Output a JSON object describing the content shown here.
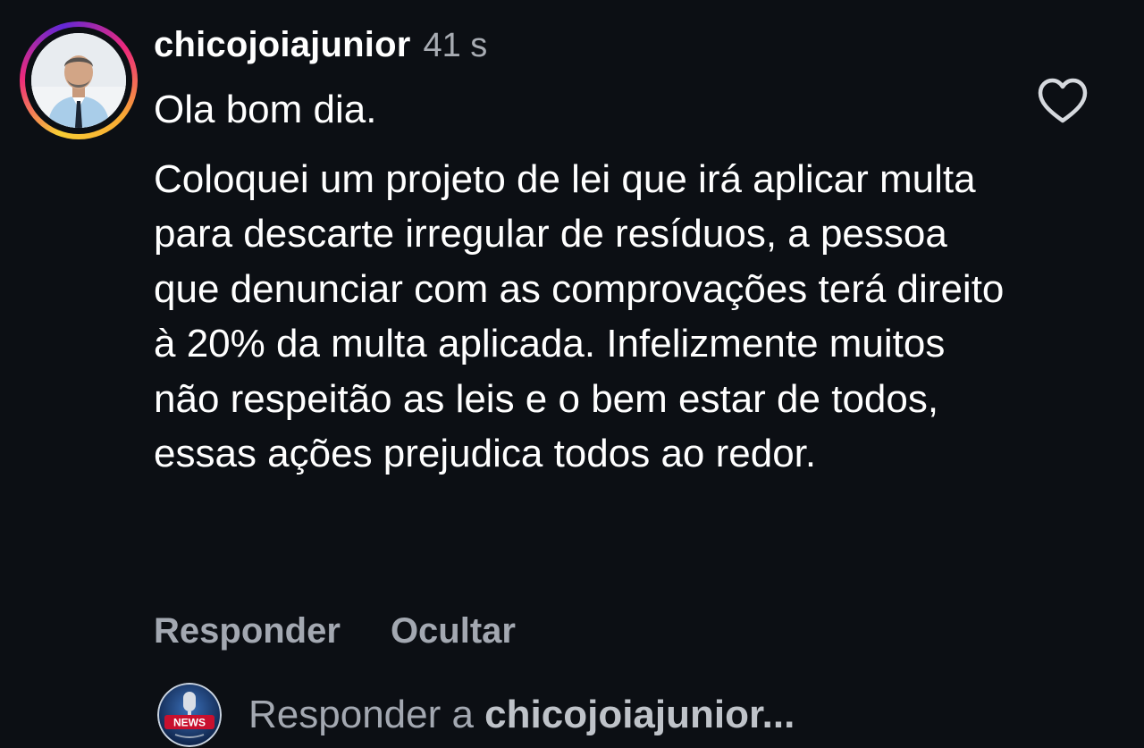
{
  "comment": {
    "username": "chicojoiajunior",
    "time": "41 s",
    "greeting": "Ola bom dia.",
    "body": "Coloquei um projeto de lei que irá aplicar multa para descarte irregular de resíduos, a pessoa que denunciar com as comprovações terá direito à 20% da multa aplicada. Infelizmente muitos não respeitão as leis e o bem estar de todos, essas ações prejudica todos ao redor."
  },
  "actions": {
    "reply_label": "Responder",
    "hide_label": "Ocultar"
  },
  "reply_bar": {
    "prefix": "Responder a ",
    "target": "chicojoiajunior..."
  },
  "logo_text": "NEWS",
  "icons": {
    "like": "heart-outline-icon"
  },
  "colors": {
    "background": "#0c0f14",
    "muted_text": "#a3a8b1",
    "story_ring_start": "#f9ce34",
    "story_ring_end": "#ee2a7b"
  }
}
